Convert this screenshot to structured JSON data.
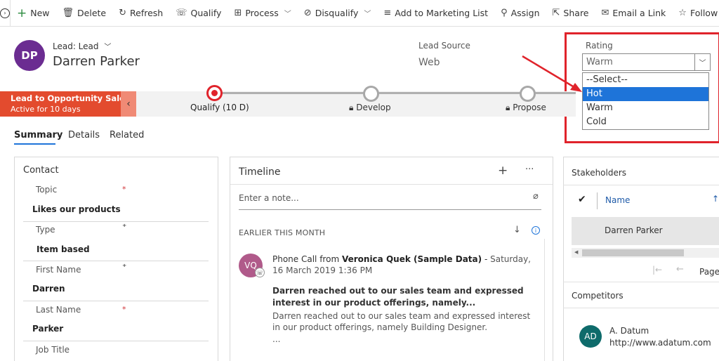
{
  "commandbar": {
    "items": [
      {
        "label": "New",
        "icon": "plus-icon"
      },
      {
        "label": "Delete",
        "icon": "trash-icon"
      },
      {
        "label": "Refresh",
        "icon": "refresh-icon"
      },
      {
        "label": "Qualify",
        "icon": "qualify-icon"
      },
      {
        "label": "Process",
        "icon": "process-icon"
      },
      {
        "label": "Disqualify",
        "icon": "disqualify-icon"
      },
      {
        "label": "Add to Marketing List",
        "icon": "list-icon"
      },
      {
        "label": "Assign",
        "icon": "person-icon"
      },
      {
        "label": "Share",
        "icon": "share-icon"
      },
      {
        "label": "Email a Link",
        "icon": "email-icon"
      },
      {
        "label": "Follow",
        "icon": "star-icon"
      }
    ]
  },
  "header": {
    "avatar_initials": "DP",
    "avatar_color": "#6b2c91",
    "entity_type": "Lead: Lead",
    "name": "Darren Parker",
    "lead_source_label": "Lead Source",
    "lead_source_value": "Web",
    "rating_label": "Rating",
    "rating_value": "Warm",
    "rating_options": [
      "--Select--",
      "Hot",
      "Warm",
      "Cold"
    ],
    "rating_highlighted": "Hot"
  },
  "process": {
    "tag_title": "Lead to Opportunity Sale...",
    "tag_subtitle": "Active for 10 days",
    "stages": [
      {
        "label": "Qualify  (10 D)"
      },
      {
        "label": "Develop"
      },
      {
        "label": "Propose"
      }
    ],
    "accent": "#e34b2e"
  },
  "tabs": [
    {
      "label": "Summary"
    },
    {
      "label": "Details"
    },
    {
      "label": "Related"
    }
  ],
  "contact": {
    "title": "Contact",
    "fields": [
      {
        "label": "Topic",
        "value": "Likes our products",
        "marker": "*"
      },
      {
        "label": "Type",
        "value": "Item based",
        "marker": "⁺"
      },
      {
        "label": "First Name",
        "value": "Darren",
        "marker": "⁺"
      },
      {
        "label": "Last Name",
        "value": "Parker",
        "marker": "*"
      },
      {
        "label": "Job Title",
        "value": "",
        "marker": ""
      }
    ]
  },
  "timeline": {
    "title": "Timeline",
    "note_placeholder": "Enter a note...",
    "group_label": "EARLIER THIS MONTH",
    "entry": {
      "avatar_initials": "VQ",
      "prefix": "Phone Call from",
      "from": "Veronica Quek (Sample Data)",
      "date": "Saturday, 16 March 2019 1:36 PM",
      "subject": "Darren reached out to our sales team and expressed interest in our product offerings, namely...",
      "body": "Darren reached out to our sales team and expressed interest in our product offerings, namely Building Designer.",
      "ellipsis": "..."
    }
  },
  "stakeholders": {
    "title": "Stakeholders",
    "column_name": "Name",
    "rows": [
      "Darren Parker"
    ],
    "page_label": "Page"
  },
  "competitors": {
    "title": "Competitors",
    "items": [
      {
        "initials": "AD",
        "name": "A. Datum",
        "url": "http://www.adatum.com",
        "color": "#0e6b6b"
      }
    ]
  }
}
